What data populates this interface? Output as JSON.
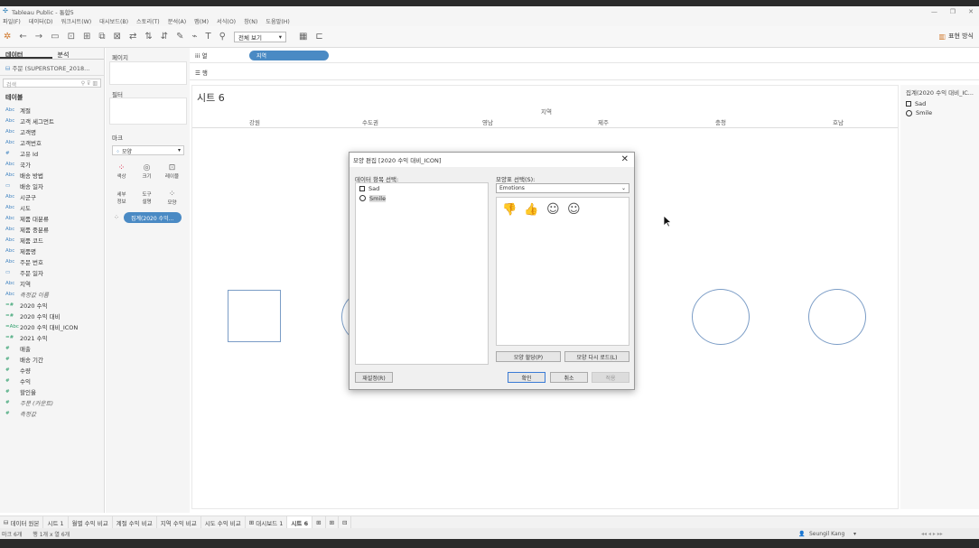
{
  "window": {
    "title": "Tableau Public - 통합5"
  },
  "menu": [
    "파일(F)",
    "데이터(D)",
    "워크시트(W)",
    "대시보드(B)",
    "스토리(T)",
    "분석(A)",
    "맵(M)",
    "서식(O)",
    "창(N)",
    "도움말(H)"
  ],
  "toolbar": {
    "view_select": "전체 보기",
    "show_me": "표현 방식"
  },
  "sidebar": {
    "tabs": [
      "데이터",
      "분석"
    ],
    "datasource": "주문 (SUPERSTORE_2018...",
    "search_placeholder": "검색",
    "tables_header": "테이블",
    "fields": [
      {
        "icon": "Abc",
        "name": "계절",
        "kind": "dim"
      },
      {
        "icon": "Abc",
        "name": "고객 세그먼트",
        "kind": "dim"
      },
      {
        "icon": "Abc",
        "name": "고객명",
        "kind": "dim"
      },
      {
        "icon": "Abc",
        "name": "고객번호",
        "kind": "dim"
      },
      {
        "icon": "#",
        "name": "고유 Id",
        "kind": "dim"
      },
      {
        "icon": "Abc",
        "name": "국가",
        "kind": "dim"
      },
      {
        "icon": "Abc",
        "name": "배송 방법",
        "kind": "dim"
      },
      {
        "icon": "▭",
        "name": "배송 일자",
        "kind": "dim"
      },
      {
        "icon": "Abc",
        "name": "시군구",
        "kind": "dim"
      },
      {
        "icon": "Abc",
        "name": "시도",
        "kind": "dim"
      },
      {
        "icon": "Abc",
        "name": "제품 대분류",
        "kind": "dim"
      },
      {
        "icon": "Abc",
        "name": "제품 중분류",
        "kind": "dim"
      },
      {
        "icon": "Abc",
        "name": "제품 코드",
        "kind": "dim"
      },
      {
        "icon": "Abc",
        "name": "제품명",
        "kind": "dim"
      },
      {
        "icon": "Abc",
        "name": "주문 번호",
        "kind": "dim"
      },
      {
        "icon": "▭",
        "name": "주문 일자",
        "kind": "dim"
      },
      {
        "icon": "Abc",
        "name": "지역",
        "kind": "dim"
      },
      {
        "icon": "Abc",
        "name": "측정값 이름",
        "kind": "dim",
        "italic": true
      },
      {
        "icon": "=#",
        "name": "2020 수익",
        "kind": "mea"
      },
      {
        "icon": "=#",
        "name": "2020 수익 대비",
        "kind": "mea"
      },
      {
        "icon": "=Abc",
        "name": "2020 수익 대비_ICON",
        "kind": "mea"
      },
      {
        "icon": "=#",
        "name": "2021 수익",
        "kind": "mea"
      },
      {
        "icon": "#",
        "name": "매출",
        "kind": "mea"
      },
      {
        "icon": "#",
        "name": "배송 기간",
        "kind": "mea"
      },
      {
        "icon": "#",
        "name": "수량",
        "kind": "mea"
      },
      {
        "icon": "#",
        "name": "수익",
        "kind": "mea"
      },
      {
        "icon": "#",
        "name": "할인율",
        "kind": "mea"
      },
      {
        "icon": "#",
        "name": "주문 (카운트)",
        "kind": "mea",
        "italic": true
      },
      {
        "icon": "#",
        "name": "측정값",
        "kind": "mea",
        "italic": true
      }
    ]
  },
  "cards": {
    "pages": "페이지",
    "filters": "필터",
    "marks": "마크",
    "mark_type": "모양",
    "mark_buttons": [
      "색상",
      "크기",
      "레이블",
      "세부 정보",
      "도구 설명",
      "모양"
    ],
    "shape_pill": "집계(2020 수익..."
  },
  "shelves": {
    "columns_label": "열",
    "columns_pill": "지역",
    "rows_label": "행"
  },
  "sheet": {
    "title": "시트 6",
    "header_label": "지역",
    "columns": [
      "강원",
      "수도권",
      "영남",
      "제주",
      "충청",
      "호남"
    ]
  },
  "legend": {
    "title": "집계(2020 수익 대비_IC...",
    "items": [
      "Sad",
      "Smile"
    ]
  },
  "dialog": {
    "title": "모양 편집 [2020 수익 대비_ICON]",
    "select_item_label": "데이터 항목 선택:",
    "items": [
      "Sad",
      "Smile"
    ],
    "palette_label": "모양표 선택(S):",
    "palette_value": "Emotions",
    "assign_button": "모양 할당(P)",
    "reload_button": "모양 다시 로드(L)",
    "reset_button": "재설정(R)",
    "ok_button": "확인",
    "cancel_button": "취소",
    "apply_button": "적용"
  },
  "bottom_tabs": [
    "데이터 원본",
    "시트 1",
    "월별 수익 비교",
    "계절 수익 비교",
    "지역 수익 비교",
    "시도 수익 비교",
    "대시보드 1",
    "시트 6"
  ],
  "status": {
    "marks": "마크 6개",
    "rows_cols": "행 1개 x 열 6개",
    "user": "Seungil Kang"
  }
}
